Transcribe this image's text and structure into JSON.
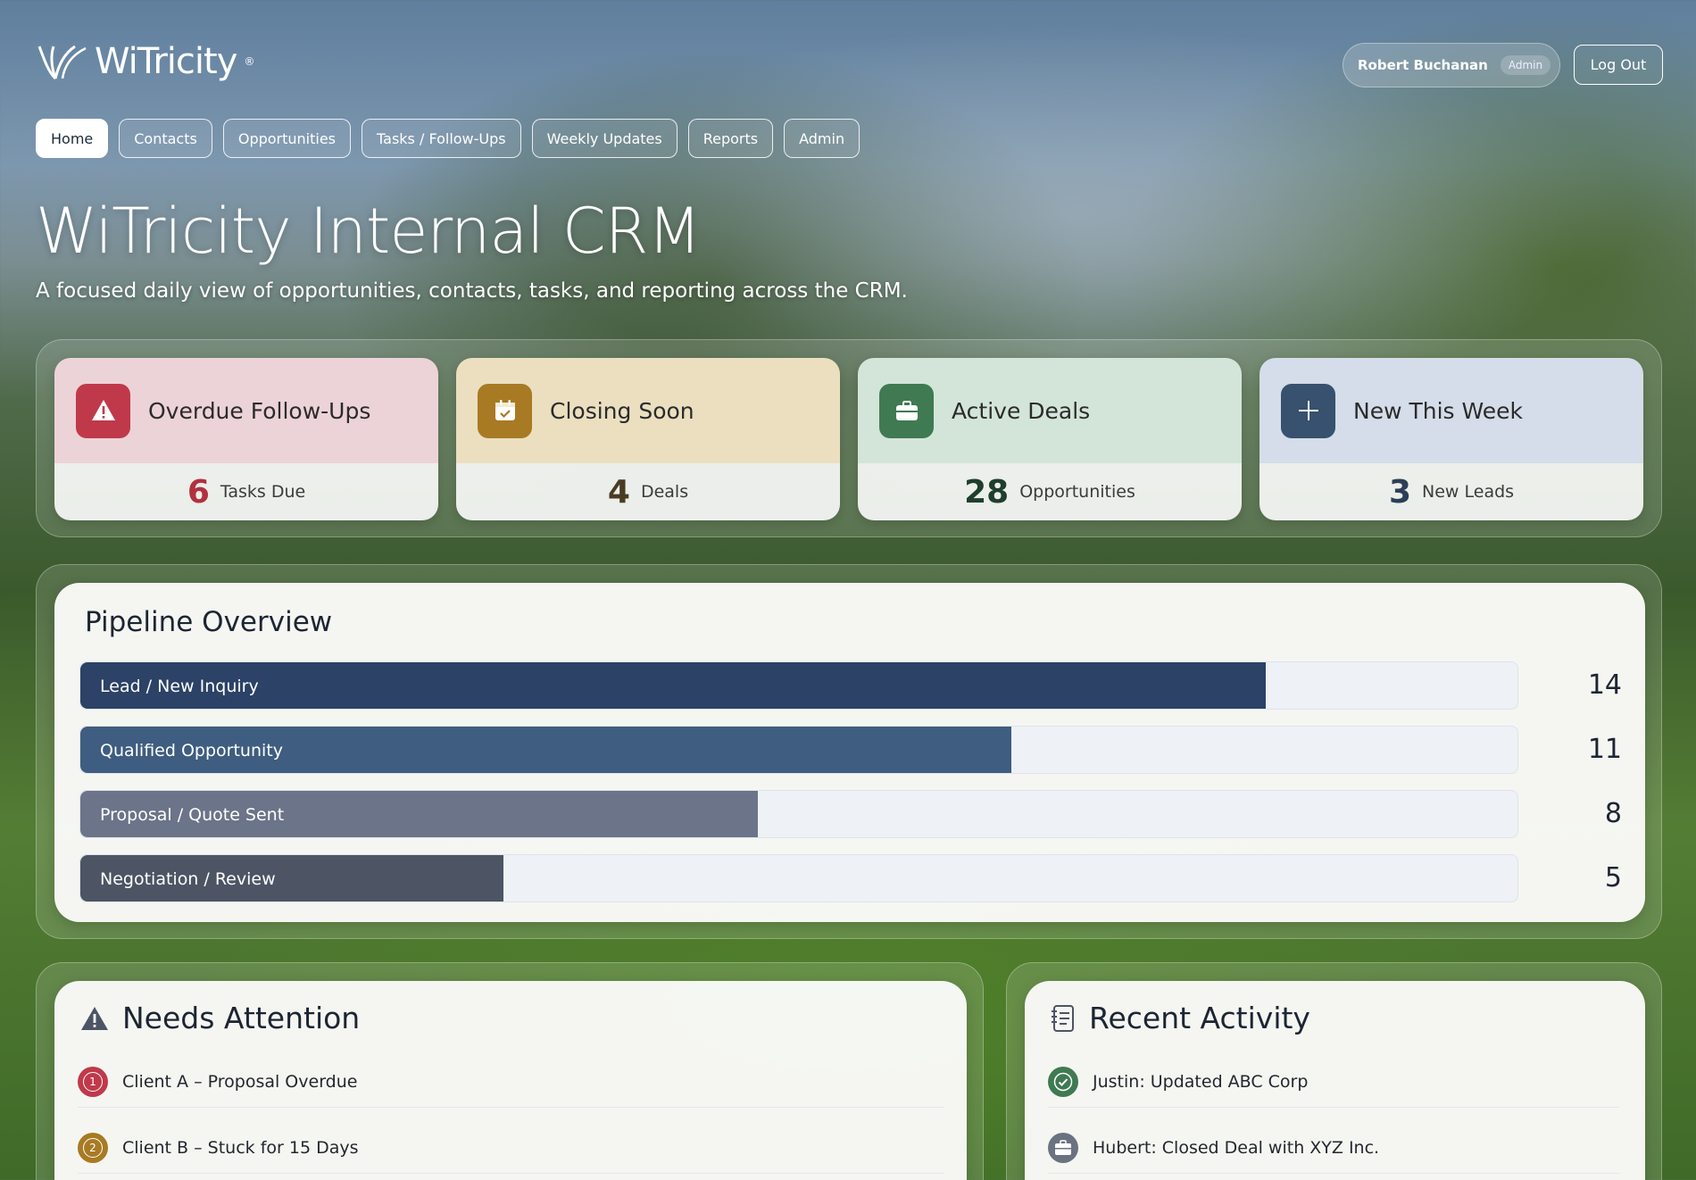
{
  "brand": {
    "name": "WiTricity",
    "tm": "®"
  },
  "user": {
    "name": "Robert Buchanan",
    "role": "Admin",
    "logout_label": "Log Out"
  },
  "nav": {
    "tabs": [
      "Home",
      "Contacts",
      "Opportunities",
      "Tasks / Follow-Ups",
      "Weekly Updates",
      "Reports",
      "Admin"
    ],
    "active": "Home"
  },
  "hero": {
    "title": "WiTricity Internal CRM",
    "subtitle": "A focused daily view of opportunities, contacts, tasks, and reporting across the CRM."
  },
  "stats": [
    {
      "label": "Overdue Follow-Ups",
      "value": "6",
      "unit": "Tasks Due",
      "icon": "warning-icon",
      "accent": "#c0394a"
    },
    {
      "label": "Closing Soon",
      "value": "4",
      "unit": "Deals",
      "icon": "calendar-check-icon",
      "accent": "#a87a23"
    },
    {
      "label": "Active Deals",
      "value": "28",
      "unit": "Opportunities",
      "icon": "briefcase-icon",
      "accent": "#3f7a52"
    },
    {
      "label": "New This Week",
      "value": "3",
      "unit": "New Leads",
      "icon": "plus-icon",
      "accent": "#37516e"
    }
  ],
  "pipeline": {
    "title": "Pipeline Overview",
    "max": 17,
    "stages": [
      {
        "label": "Lead / New Inquiry",
        "value": 14,
        "color": "#2c4266"
      },
      {
        "label": "Qualified Opportunity",
        "value": 11,
        "color": "#3e5d80"
      },
      {
        "label": "Proposal / Quote Sent",
        "value": 8,
        "color": "#6b7488"
      },
      {
        "label": "Negotiation / Review",
        "value": 5,
        "color": "#4d5464"
      }
    ]
  },
  "needs_attention": {
    "title": "Needs Attention",
    "items": [
      {
        "num": "1",
        "text": "Client A – Proposal Overdue",
        "color": "#c0394a"
      },
      {
        "num": "2",
        "text": "Client B – Stuck for 15 Days",
        "color": "#a87a23"
      }
    ]
  },
  "recent_activity": {
    "title": "Recent Activity",
    "items": [
      {
        "text": "Justin: Updated ABC Corp",
        "icon": "check-icon",
        "color": "#3f7a52"
      },
      {
        "text": "Hubert: Closed Deal with XYZ Inc.",
        "icon": "briefcase-icon",
        "color": "#6b7280"
      }
    ]
  }
}
